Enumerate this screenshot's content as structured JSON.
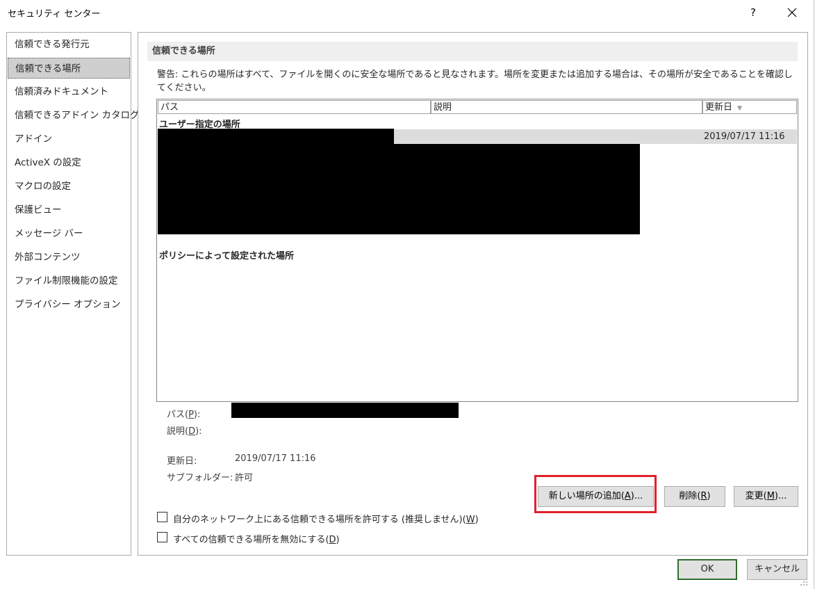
{
  "window": {
    "title": "セキュリティ センター",
    "help_label": "?",
    "close_icon": "close-icon"
  },
  "sidebar": {
    "items": [
      {
        "label": "信頼できる発行元"
      },
      {
        "label": "信頼できる場所",
        "selected": true
      },
      {
        "label": "信頼済みドキュメント"
      },
      {
        "label": "信頼できるアドイン カタログ"
      },
      {
        "label": "アドイン"
      },
      {
        "label": "ActiveX の設定"
      },
      {
        "label": "マクロの設定"
      },
      {
        "label": "保護ビュー"
      },
      {
        "label": "メッセージ バー"
      },
      {
        "label": "外部コンテンツ"
      },
      {
        "label": "ファイル制限機能の設定"
      },
      {
        "label": "プライバシー オプション"
      }
    ]
  },
  "main": {
    "section_title": "信頼できる場所",
    "warning": "警告: これらの場所はすべて、ファイルを開くのに安全な場所であると見なされます。場所を変更または追加する場合は、その場所が安全であることを確認してください。",
    "columns": {
      "path": "パス",
      "description": "説明",
      "modified": "更新日"
    },
    "groups": {
      "user": "ユーザー指定の場所",
      "policy": "ポリシーによって設定された場所"
    },
    "selected_row_date": "2019/07/17 11:16",
    "details": {
      "path_label_pre": "パス(",
      "path_key": "P",
      "path_label_post": "):",
      "desc_label_pre": "説明(",
      "desc_key": "D",
      "desc_label_post": "):",
      "modified_label": "更新日:",
      "modified_value": "2019/07/17 11:16",
      "subfolders_label": "サブフォルダー:",
      "subfolders_value": "許可"
    },
    "buttons": {
      "add_pre": "新しい場所の追加(",
      "add_key": "A",
      "add_post": ")...",
      "remove_pre": "削除(",
      "remove_key": "R",
      "remove_post": ")",
      "modify_pre": "変更(",
      "modify_key": "M",
      "modify_post": ")..."
    },
    "checkboxes": {
      "network_pre": "自分のネットワーク上にある信頼できる場所を許可する (推奨しません)(",
      "network_key": "W",
      "network_post": ")",
      "network_checked": false,
      "disable_pre": "すべての信頼できる場所を無効にする(",
      "disable_key": "D",
      "disable_post": ")",
      "disable_checked": false
    }
  },
  "footer": {
    "ok_label": "OK",
    "cancel_label": "キャンセル"
  },
  "colors": {
    "highlight": "#e0202a",
    "selected_bg": "#cfcfcf",
    "ok_border": "#2e6e2e"
  }
}
